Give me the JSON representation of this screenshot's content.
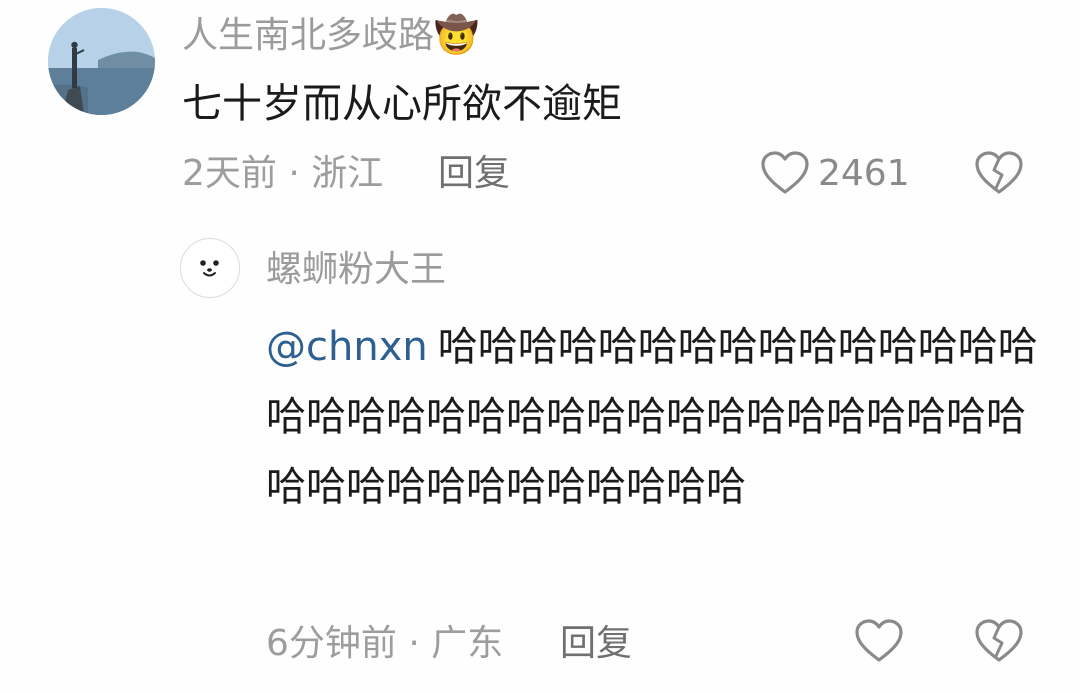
{
  "top_comment": {
    "username": "人生南北多歧路",
    "username_emoji": "🤠",
    "text": "七十岁而从心所欲不逾矩",
    "meta": "2天前 · 浙江",
    "reply_label": "回复",
    "like_count": "2461"
  },
  "reply_comment": {
    "username": "螺蛳粉大王",
    "mention": "@chnxn",
    "text": "哈哈哈哈哈哈哈哈哈哈哈哈哈哈哈哈哈哈哈哈哈哈哈哈哈哈哈哈哈哈哈哈哈哈哈哈哈哈哈哈哈哈哈哈哈哈",
    "meta": "6分钟前 · 广东",
    "reply_label": "回复"
  },
  "icons": {
    "like": "heart-outline-icon",
    "dislike": "broken-heart-icon"
  },
  "colors": {
    "mention": "#2d5f91",
    "icon_gray": "#8a8a8a"
  }
}
